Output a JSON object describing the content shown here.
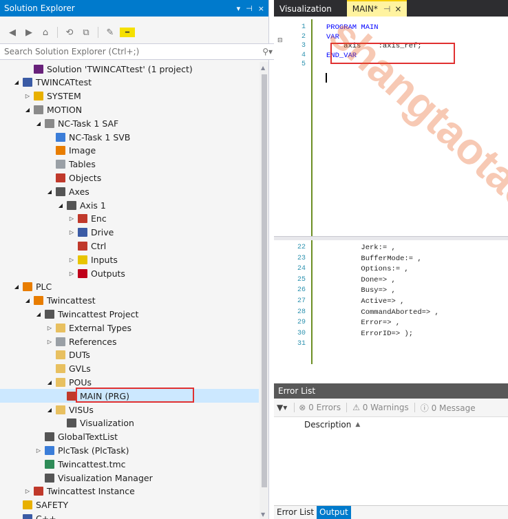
{
  "solution_explorer": {
    "title": "Solution Explorer",
    "pin_label": "― พ",
    "close_label": "×",
    "search_placeholder": "Search Solution Explorer (Ctrl+;)",
    "tree": [
      {
        "label": "Solution 'TWINCATtest' (1 project)",
        "icon": "solution-icon",
        "color": "#68217a",
        "arrow": "",
        "selected": false
      },
      {
        "label": "TWINCATtest",
        "icon": "project-icon",
        "color": "#3b5ba5",
        "arrow": "◢",
        "selected": false
      },
      {
        "label": "SYSTEM",
        "icon": "system-icon",
        "color": "#e8b000",
        "arrow": "▷",
        "selected": false
      },
      {
        "label": "MOTION",
        "icon": "motion-icon",
        "color": "#8a8a8a",
        "arrow": "◢",
        "selected": false
      },
      {
        "label": "NC-Task 1 SAF",
        "icon": "task-icon",
        "color": "#8a8a8a",
        "arrow": "◢",
        "selected": false
      },
      {
        "label": "NC-Task 1 SVB",
        "icon": "file-icon",
        "color": "#3b7dd8",
        "arrow": "",
        "selected": false
      },
      {
        "label": "Image",
        "icon": "image-icon",
        "color": "#e87d00",
        "arrow": "",
        "selected": false
      },
      {
        "label": "Tables",
        "icon": "table-icon",
        "color": "#9aa0a6",
        "arrow": "",
        "selected": false
      },
      {
        "label": "Objects",
        "icon": "objects-icon",
        "color": "#c0392b",
        "arrow": "",
        "selected": false
      },
      {
        "label": "Axes",
        "icon": "axes-icon",
        "color": "#555555",
        "arrow": "◢",
        "selected": false
      },
      {
        "label": "Axis 1",
        "icon": "axis-icon",
        "color": "#555555",
        "arrow": "◢",
        "selected": false
      },
      {
        "label": "Enc",
        "icon": "encoder-icon",
        "color": "#c0392b",
        "arrow": "▷",
        "selected": false
      },
      {
        "label": "Drive",
        "icon": "drive-icon",
        "color": "#3b5ba5",
        "arrow": "▷",
        "selected": false
      },
      {
        "label": "Ctrl",
        "icon": "ctrl-icon",
        "color": "#c0392b",
        "arrow": "",
        "selected": false
      },
      {
        "label": "Inputs",
        "icon": "inputs-icon",
        "color": "#e8c400",
        "arrow": "▷",
        "selected": false
      },
      {
        "label": "Outputs",
        "icon": "outputs-icon",
        "color": "#c0001a",
        "arrow": "▷",
        "selected": false
      },
      {
        "label": "PLC",
        "icon": "plc-icon",
        "color": "#e87d00",
        "arrow": "◢",
        "selected": false
      },
      {
        "label": "Twincattest",
        "icon": "plc-project-icon",
        "color": "#e87d00",
        "arrow": "◢",
        "selected": false
      },
      {
        "label": "Twincattest Project",
        "icon": "project-file-icon",
        "color": "#555555",
        "arrow": "◢",
        "selected": false
      },
      {
        "label": "External Types",
        "icon": "folder-icon",
        "color": "#e8c060",
        "arrow": "▷",
        "selected": false
      },
      {
        "label": "References",
        "icon": "references-icon",
        "color": "#9aa0a6",
        "arrow": "▷",
        "selected": false
      },
      {
        "label": "DUTs",
        "icon": "folder-icon",
        "color": "#e8c060",
        "arrow": "",
        "selected": false
      },
      {
        "label": "GVLs",
        "icon": "folder-icon",
        "color": "#e8c060",
        "arrow": "",
        "selected": false
      },
      {
        "label": "POUs",
        "icon": "folder-open-icon",
        "color": "#e8c060",
        "arrow": "◢",
        "selected": false
      },
      {
        "label": "MAIN (PRG)",
        "icon": "pou-icon",
        "color": "#c0392b",
        "arrow": "",
        "selected": true
      },
      {
        "label": "VISUs",
        "icon": "folder-open-icon",
        "color": "#e8c060",
        "arrow": "◢",
        "selected": false
      },
      {
        "label": "Visualization",
        "icon": "visualization-icon",
        "color": "#555555",
        "arrow": "",
        "selected": false
      },
      {
        "label": "GlobalTextList",
        "icon": "textlist-icon",
        "color": "#555555",
        "arrow": "",
        "selected": false
      },
      {
        "label": "PlcTask (PlcTask)",
        "icon": "plctask-icon",
        "color": "#3b7dd8",
        "arrow": "▷",
        "selected": false
      },
      {
        "label": "Twincattest.tmc",
        "icon": "tmc-icon",
        "color": "#2e8b57",
        "arrow": "",
        "selected": false
      },
      {
        "label": "Visualization Manager",
        "icon": "vismanager-icon",
        "color": "#555555",
        "arrow": "",
        "selected": false
      },
      {
        "label": "Twincattest Instance",
        "icon": "instance-icon",
        "color": "#c0392b",
        "arrow": "▷",
        "selected": false
      },
      {
        "label": "SAFETY",
        "icon": "safety-icon",
        "color": "#e8b000",
        "arrow": "",
        "selected": false
      },
      {
        "label": "C++",
        "icon": "cpp-icon",
        "color": "#3b5ba5",
        "arrow": "",
        "selected": false
      }
    ]
  },
  "editor": {
    "tabs": [
      "Visualization",
      "MAIN*"
    ],
    "tab_pin": "―",
    "tab_close": "×",
    "declaration": [
      {
        "n": "1",
        "text": "PROGRAM MAIN",
        "kw": true
      },
      {
        "n": "2",
        "text": "VAR",
        "kw": true
      },
      {
        "n": "3",
        "text": "    axis    :axis_ref;",
        "kw": false
      },
      {
        "n": "4",
        "text": "END_VAR",
        "kw": true
      },
      {
        "n": "5",
        "text": "",
        "kw": false
      }
    ],
    "body": [
      {
        "n": "22",
        "text": "        Jerk:= ,"
      },
      {
        "n": "23",
        "text": "        BufferMode:= ,"
      },
      {
        "n": "24",
        "text": "        Options:= ,"
      },
      {
        "n": "25",
        "text": "        Done=> ,"
      },
      {
        "n": "26",
        "text": "        Busy=> ,"
      },
      {
        "n": "27",
        "text": "        Active=> ,"
      },
      {
        "n": "28",
        "text": "        CommandAborted=> ,"
      },
      {
        "n": "29",
        "text": "        Error=> ,"
      },
      {
        "n": "30",
        "text": "        ErrorID=> );"
      },
      {
        "n": "31",
        "text": ""
      }
    ]
  },
  "error_list": {
    "title": "Error List",
    "errors": "0 Errors",
    "warnings": "0 Warnings",
    "messages": "0 Message",
    "column": "Description",
    "bottom_tabs": [
      "Error List",
      "Output"
    ]
  },
  "watermark": "shangtaotao",
  "colors": {
    "accent": "#007acc",
    "highlight_box": "#e03030"
  }
}
